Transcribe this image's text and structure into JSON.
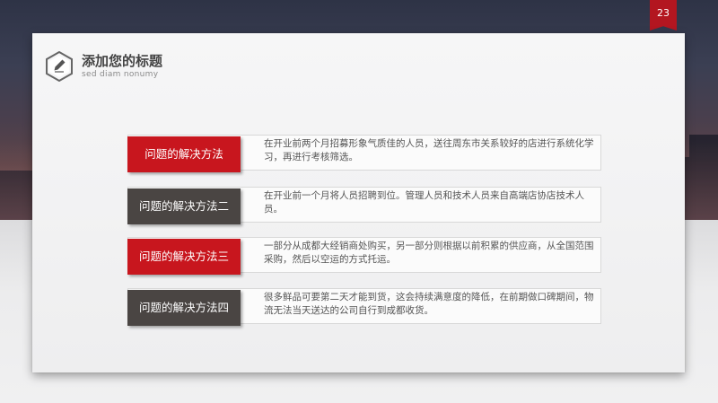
{
  "page_number": "23",
  "header": {
    "title": "添加您的标题",
    "subtitle": "sed diam nonumy",
    "icon": "pencil-icon"
  },
  "rows": [
    {
      "label": "问题的解决方法",
      "text": "在开业前两个月招募形象气质佳的人员，送往周东市关系较好的店进行系统化学习，再进行考核筛选。",
      "style": "red"
    },
    {
      "label": "问题的解决方法二",
      "text": "在开业前一个月将人员招聘到位。管理人员和技术人员来自高端店协店技术人员。",
      "style": "dark"
    },
    {
      "label": "问题的解决方法三",
      "text": "一部分从成都大经销商处购买，另一部分则根据以前积累的供应商，从全国范围采购，然后以空运的方式托运。",
      "style": "red"
    },
    {
      "label": "问题的解决方法四",
      "text": "很多鲜品可要第二天才能到货，这会持续满意度的降低，在前期做口碑期间，物流无法当天送达的公司自行到成都收货。",
      "style": "dark"
    }
  ],
  "colors": {
    "accent": "#c8161e",
    "dark": "#4a4543"
  }
}
